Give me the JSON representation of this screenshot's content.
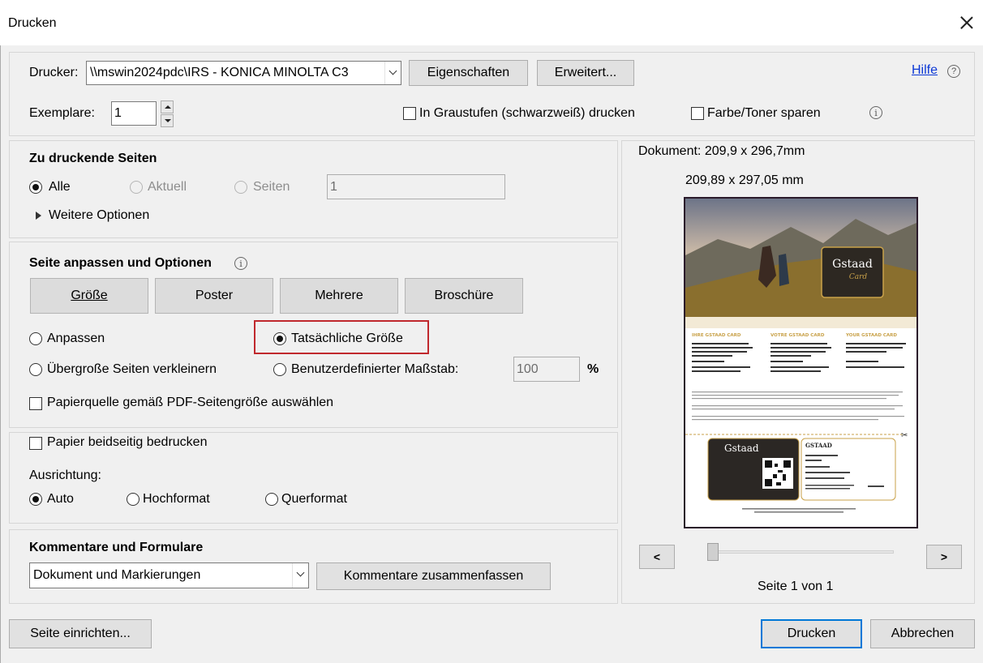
{
  "window": {
    "title": "Drucken"
  },
  "printer": {
    "label": "Drucker:",
    "selected": "\\\\mswin2024pdc\\IRS - KONICA MINOLTA C3",
    "properties_button": "Eigenschaften",
    "advanced_button": "Erweitert...",
    "help_link": "Hilfe"
  },
  "copies": {
    "label": "Exemplare:",
    "value": "1"
  },
  "options": {
    "grayscale": "In Graustufen (schwarzweiß) drucken",
    "save_toner": "Farbe/Toner sparen"
  },
  "pages_section": {
    "heading": "Zu druckende Seiten",
    "all": "Alle",
    "current": "Aktuell",
    "pages": "Seiten",
    "pages_value": "1",
    "more_options": "Weitere Optionen"
  },
  "sizing_section": {
    "heading": "Seite anpassen und Optionen",
    "buttons": [
      "Größe",
      "Poster",
      "Mehrere",
      "Broschüre"
    ],
    "fit": "Anpassen",
    "actual_size": "Tatsächliche Größe",
    "shrink": "Übergroße Seiten verkleinern",
    "custom_scale": "Benutzerdefinierter Maßstab:",
    "scale_value": "100",
    "percent": "%",
    "paper_source": "Papierquelle gemäß PDF-Seitengröße auswählen"
  },
  "duplex_section": {
    "duplex": "Papier beidseitig bedrucken",
    "orientation_label": "Ausrichtung:",
    "auto": "Auto",
    "portrait": "Hochformat",
    "landscape": "Querformat"
  },
  "comments_section": {
    "heading": "Kommentare und Formulare",
    "selected": "Dokument und Markierungen",
    "summarize_button": "Kommentare zusammenfassen"
  },
  "preview": {
    "document_size": "Dokument: 209,9 x 296,7mm",
    "paper_size": "209,89 x 297,05 mm",
    "prev": "<",
    "next": ">",
    "page_info": "Seite 1 von 1",
    "card_brand": "Gstaad",
    "card_sub": "Card",
    "stub_brand": "GSTAAD",
    "page_heads": [
      "IHRE GSTAAD CARD",
      "VOTRE GSTAAD CARD",
      "YOUR GSTAAD CARD"
    ]
  },
  "footer": {
    "page_setup": "Seite einrichten...",
    "print": "Drucken",
    "cancel": "Abbrechen"
  },
  "colors": {
    "accent": "#0078d7",
    "highlight": "#c0282d",
    "link": "#0b38d6",
    "gold": "#c9a24a"
  }
}
